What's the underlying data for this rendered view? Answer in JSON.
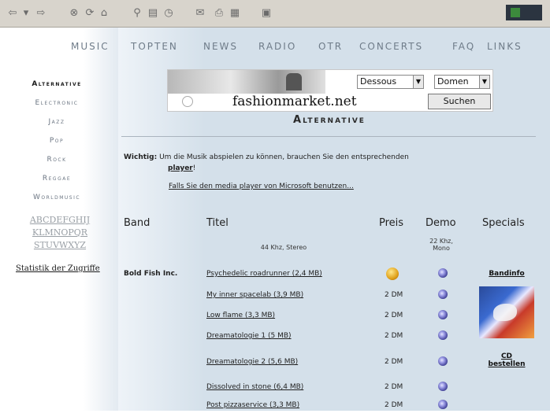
{
  "toolbar": {
    "buttons": [
      "back-arrow",
      "forward-arrow",
      "stop",
      "refresh",
      "home",
      "search",
      "favorites",
      "history",
      "mail",
      "print",
      "edit",
      "discuss"
    ]
  },
  "nav": {
    "items": [
      "MUSIC",
      "TOPTEN",
      "NEWS",
      "RADIO",
      "OTR",
      "CONCERTS",
      "FAQ",
      "LINKS"
    ]
  },
  "sidebar": {
    "genres": [
      "Alternative",
      "Electronic",
      "Jazz",
      "Pop",
      "Rock",
      "Reggae",
      "Worldmusic"
    ],
    "active_genre": "Alternative",
    "alphabet_rows": [
      "ABCDEFGHIJ",
      "KLMNOPQR",
      "STUVWXYZ"
    ],
    "stats_link": "Statistik der Zugriffe"
  },
  "banner": {
    "site": "fashionmarket.net",
    "select1": "Dessous",
    "select2": "Domen",
    "search_button": "Suchen"
  },
  "main": {
    "heading": "Alternative",
    "notice_label": "Wichtig:",
    "notice_text": "Um die Musik abspielen zu können, brauchen Sie den entsprechenden",
    "notice_player": "player",
    "notice_end": "!",
    "media_link": "Falls Sie den media player von Microsoft benutzen..."
  },
  "table": {
    "headers": {
      "band": "Band",
      "title": "Titel",
      "price": "Preis",
      "demo": "Demo",
      "specials": "Specials"
    },
    "subhead_title": "44 Khz, Stereo",
    "subhead_demo": "22 Khz, Mono",
    "band_name": "Bold Fish Inc.",
    "rows": [
      {
        "title": "Psychedelic roadrunner (2,4 MB)",
        "price": "",
        "price_icon": "free-coin-icon"
      },
      {
        "title": "My inner spacelab (3,9 MB)",
        "price": "2 DM"
      },
      {
        "title": "Low flame (3,3 MB)",
        "price": "2 DM"
      },
      {
        "title": "Dreamatologie 1 (5 MB)",
        "price": "2 DM"
      },
      {
        "title": "Dreamatologie 2 (5,6 MB)",
        "price": "2 DM"
      },
      {
        "title": "Dissolved in stone (6,4 MB)",
        "price": "2 DM"
      },
      {
        "title": "Post pizzaservice (3,3 MB)",
        "price": "2 DM"
      }
    ],
    "bandinfo_link": "Bandinfo",
    "cd_link_line1": "CD",
    "cd_link_line2": "bestellen"
  },
  "colors": {
    "page_bg": "#d4e0ea",
    "nav_text": "#6f7c89",
    "accent_dark": "#1a1a1a"
  }
}
